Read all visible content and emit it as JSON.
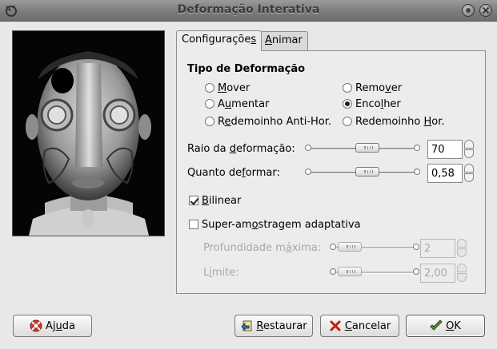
{
  "window": {
    "title": "Deformação Interativa"
  },
  "tabs": [
    {
      "label_pre": "Configuraçõe",
      "label_u": "s",
      "label_post": ""
    },
    {
      "label_pre": "",
      "label_u": "A",
      "label_post": "nimar"
    }
  ],
  "section_title": "Tipo de Deformação",
  "radios": [
    {
      "pre": "",
      "u": "M",
      "post": "over",
      "selected": false
    },
    {
      "pre": "Remo",
      "u": "v",
      "post": "er",
      "selected": false
    },
    {
      "pre": "A",
      "u": "u",
      "post": "mentar",
      "selected": false
    },
    {
      "pre": "Enco",
      "u": "l",
      "post": "her",
      "selected": true
    },
    {
      "pre": "R",
      "u": "e",
      "post": "demoinho Anti-Hor.",
      "selected": false
    },
    {
      "pre": "Redemoinho ",
      "u": "H",
      "post": "or.",
      "selected": false
    }
  ],
  "raio": {
    "pre": "Raio da ",
    "u": "d",
    "post": "eformação:",
    "value": "70",
    "level": 0.55
  },
  "quanto": {
    "pre": "Quanto de",
    "u": "f",
    "post": "ormar:",
    "value": "0,58",
    "level": 0.55
  },
  "bilinear": {
    "pre": "",
    "u": "B",
    "post": "ilinear",
    "checked": true
  },
  "super": {
    "pre": "Super-am",
    "u": "o",
    "post": "stragem adaptativa",
    "checked": false
  },
  "profundidade": {
    "pre": "Profundidade m",
    "u": "á",
    "post": "xima:",
    "value": "2",
    "level": 0.1
  },
  "limite": {
    "pre": "L",
    "u": "i",
    "post": "mite:",
    "value": "2,00",
    "level": 0.1
  },
  "buttons": {
    "help": {
      "pre": "Aj",
      "u": "u",
      "post": "da"
    },
    "reset": {
      "pre": "",
      "u": "R",
      "post": "estaurar"
    },
    "cancel": {
      "pre": "",
      "u": "C",
      "post": "ancelar"
    },
    "ok": {
      "pre": "",
      "u": "O",
      "post": "K"
    }
  },
  "colors": {
    "titlebar": "#7c7c7c",
    "panel": "#ececec",
    "text": "#000000",
    "disabled": "#a8a8a8"
  },
  "icons": {
    "app": "gimp-wilber-icon",
    "help": "lifebuoy-icon",
    "reset": "undo-icon",
    "cancel": "red-x-icon",
    "ok": "green-check-icon"
  }
}
